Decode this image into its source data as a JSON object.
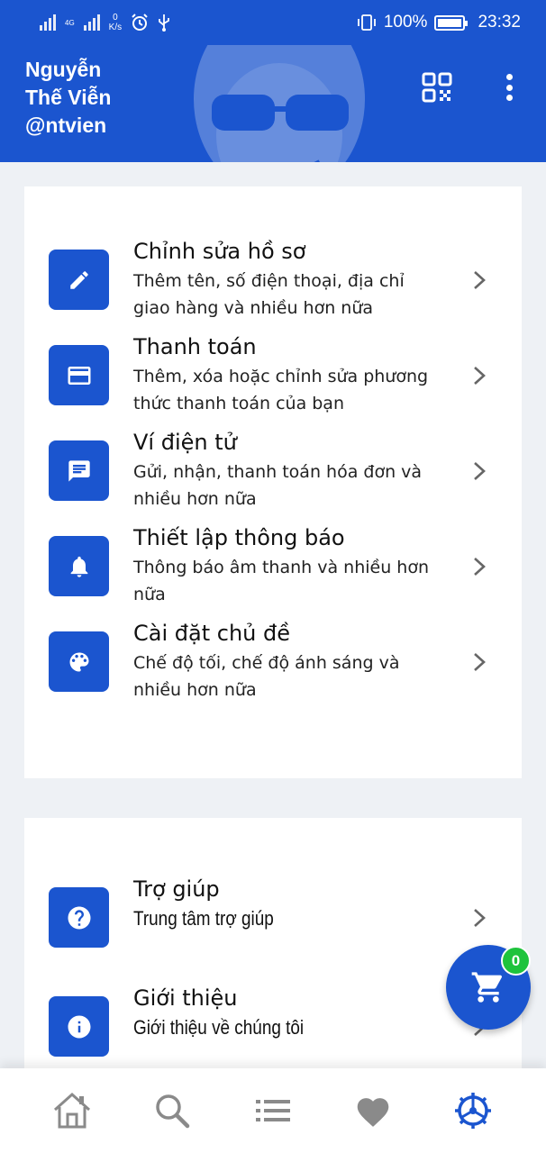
{
  "status_bar": {
    "network_tag": "4G",
    "speed_value": "0",
    "speed_unit": "K/s",
    "battery": "100%",
    "time": "23:32"
  },
  "header": {
    "name_line1": "Nguyễn",
    "name_line2": "Thế Viễn",
    "handle": "@ntvien",
    "background_color": "#1b55cf"
  },
  "menu_primary": [
    {
      "title": "Chỉnh sửa hồ sơ",
      "description": "Thêm tên, số điện thoại, địa chỉ giao hàng và nhiều hơn nữa",
      "icon": "pencil-icon"
    },
    {
      "title": "Thanh toán",
      "description": "Thêm, xóa hoặc chỉnh sửa phương thức thanh toán của bạn",
      "icon": "credit-card-icon"
    },
    {
      "title": "Ví điện tử",
      "description": "Gửi, nhận, thanh toán hóa đơn và nhiều hơn nữa",
      "icon": "message-icon"
    },
    {
      "title": "Thiết lập thông báo",
      "description": "Thông báo âm thanh và nhiều hơn nữa",
      "icon": "bell-icon"
    },
    {
      "title": "Cài đặt chủ đề",
      "description": "Chế độ tối, chế độ ánh sáng và nhiều hơn nữa",
      "icon": "palette-icon"
    }
  ],
  "menu_secondary": [
    {
      "title": "Trợ giúp",
      "description": "Trung tâm trợ giúp",
      "icon": "help-icon"
    },
    {
      "title": "Giới thiệu",
      "description": "Giới thiệu về chúng tôi",
      "icon": "info-icon"
    }
  ],
  "cart": {
    "badge_count": "0"
  },
  "bottom_nav": {
    "items": [
      "home-icon",
      "search-icon",
      "list-icon",
      "heart-icon",
      "settings-icon"
    ],
    "active": "settings-icon",
    "active_color": "#1b55cf",
    "inactive_color": "#8a8a8a"
  }
}
